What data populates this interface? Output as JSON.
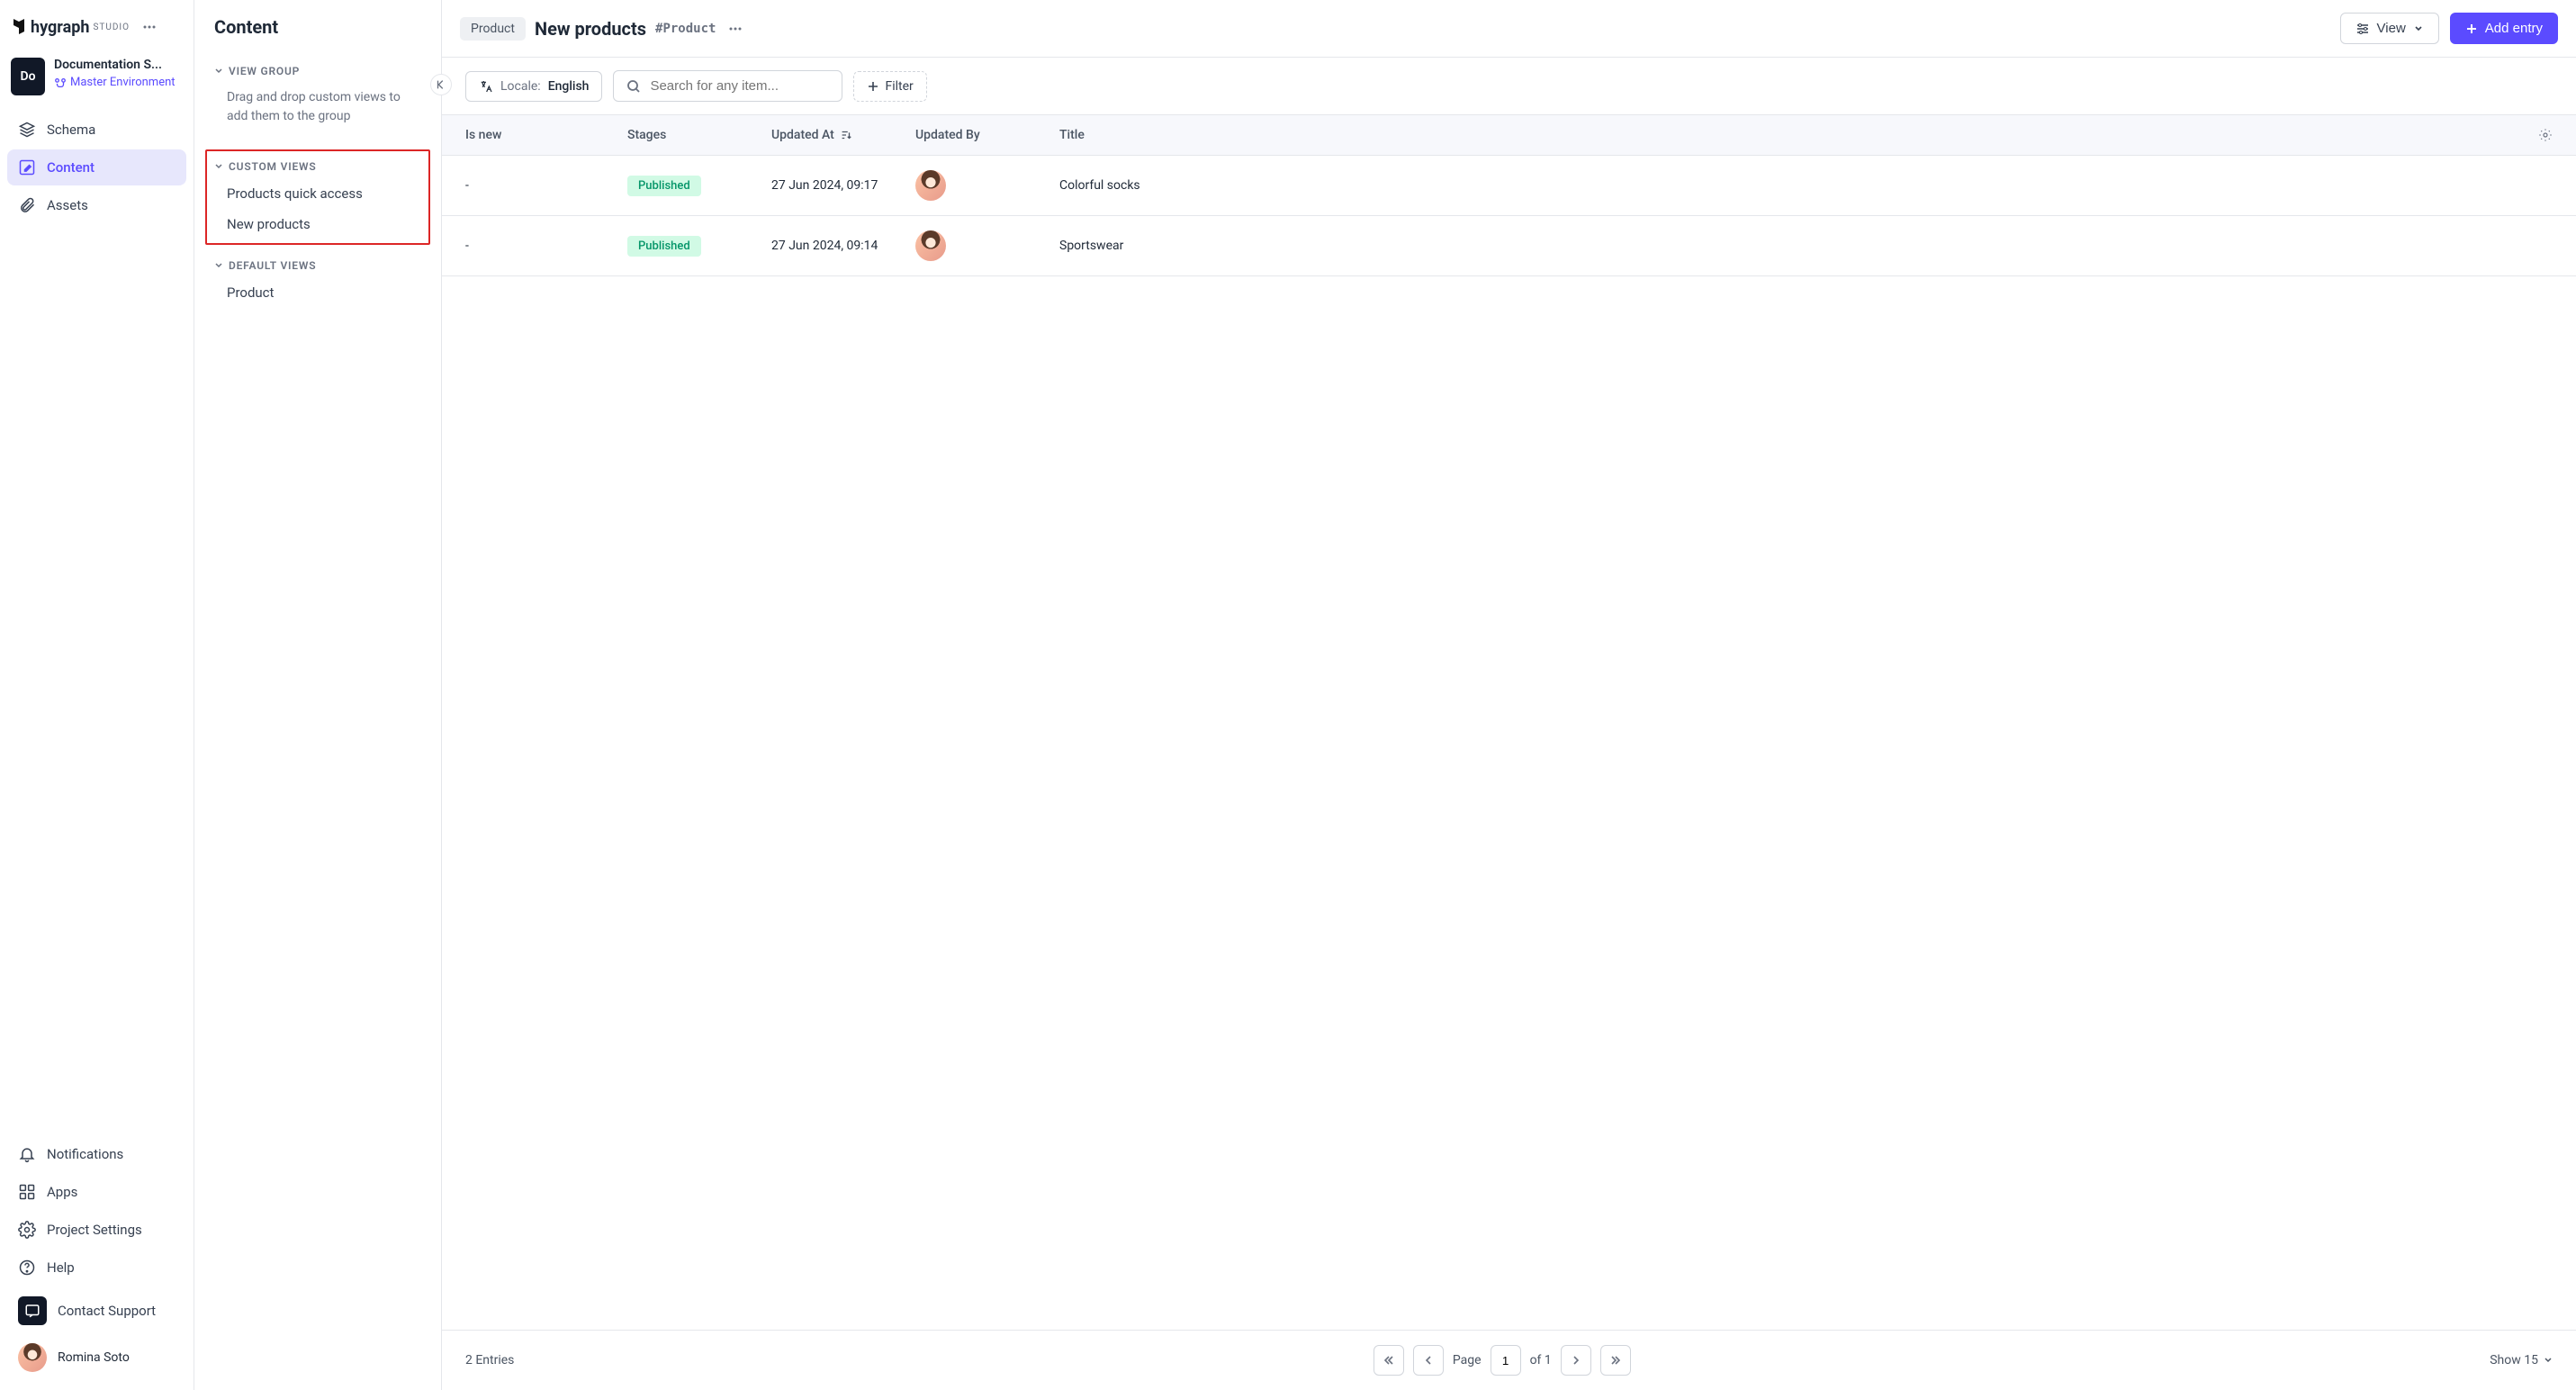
{
  "brand": {
    "name": "hygraph",
    "sub": "STUDIO"
  },
  "project": {
    "badge": "Do",
    "name": "Documentation S...",
    "env": "Master Environment"
  },
  "nav": {
    "schema": "Schema",
    "content": "Content",
    "assets": "Assets",
    "notifications": "Notifications",
    "apps": "Apps",
    "settings": "Project Settings",
    "help": "Help",
    "support": "Contact Support"
  },
  "user": {
    "name": "Romina Soto"
  },
  "viewsPanel": {
    "title": "Content",
    "group1": {
      "header": "VIEW GROUP",
      "hint": "Drag and drop custom views to add them to the group"
    },
    "group2": {
      "header": "CUSTOM VIEWS",
      "items": [
        "Products quick access",
        "New products"
      ]
    },
    "group3": {
      "header": "DEFAULT VIEWS",
      "items": [
        "Product"
      ]
    }
  },
  "header": {
    "chip": "Product",
    "title": "New products",
    "hash": "#Product",
    "viewBtn": "View",
    "addBtn": "Add entry"
  },
  "toolbar": {
    "localeLabel": "Locale:",
    "localeValue": "English",
    "searchPlaceholder": "Search for any item...",
    "filterBtn": "Filter"
  },
  "table": {
    "columns": {
      "isNew": "Is new",
      "stages": "Stages",
      "updatedAt": "Updated At",
      "updatedBy": "Updated By",
      "title": "Title"
    },
    "rows": [
      {
        "isNew": "-",
        "stage": "Published",
        "updatedAt": "27 Jun 2024, 09:17",
        "title": "Colorful socks"
      },
      {
        "isNew": "-",
        "stage": "Published",
        "updatedAt": "27 Jun 2024, 09:14",
        "title": "Sportswear"
      }
    ]
  },
  "footer": {
    "count": "2 Entries",
    "pageLabel": "Page",
    "pageValue": "1",
    "ofLabel": "of 1",
    "showLabel": "Show 15"
  }
}
